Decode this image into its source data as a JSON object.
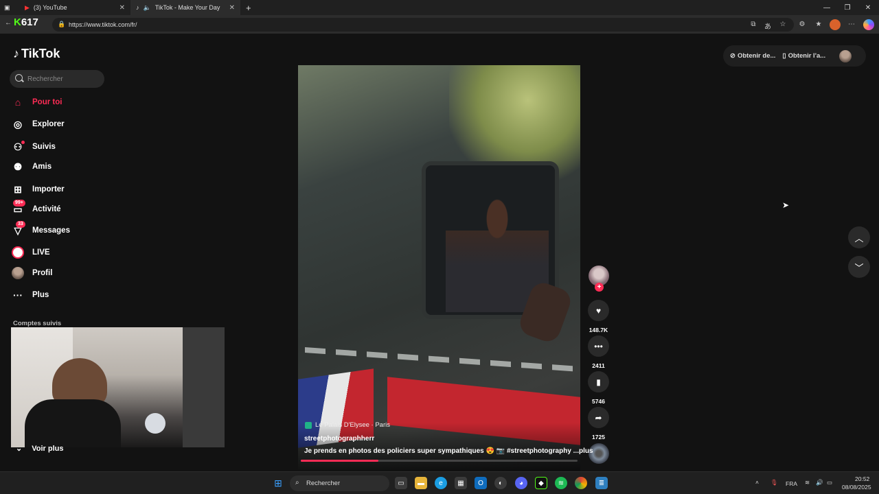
{
  "browser": {
    "tabs": [
      {
        "title": "(3) YouTube",
        "active": false
      },
      {
        "title": "TikTok - Make Your Day",
        "active": true
      }
    ],
    "new_tab": "+",
    "url": "https://www.tiktok.com/fr/",
    "extension_badge": "617"
  },
  "tiktok": {
    "logo_text": "TikTok",
    "search_placeholder": "Rechercher",
    "nav": [
      {
        "label": "Pour toi",
        "icon": "home-icon",
        "glyph": "⌂",
        "active": true
      },
      {
        "label": "Explorer",
        "icon": "compass-icon",
        "glyph": "◎"
      },
      {
        "label": "Suivis",
        "icon": "following-icon",
        "glyph": "👤"
      },
      {
        "label": "Amis",
        "icon": "friends-icon",
        "glyph": "👥"
      },
      {
        "label": "Importer",
        "icon": "upload-icon",
        "glyph": "⊞"
      },
      {
        "label": "Activité",
        "icon": "activity-icon",
        "glyph": "▭",
        "badge": "99+"
      },
      {
        "label": "Messages",
        "icon": "messages-icon",
        "glyph": "➤",
        "badge": "33"
      },
      {
        "label": "LIVE",
        "icon": "live-icon",
        "glyph": "●"
      },
      {
        "label": "Profil",
        "icon": "profile-avatar",
        "glyph": "●"
      },
      {
        "label": "Plus",
        "icon": "more-icon",
        "glyph": "···"
      }
    ],
    "followed_title": "Comptes suivis",
    "see_more": "Voir plus",
    "top_right": {
      "get_coins": "Obtenir de...",
      "get_app": "Obtenir l'a..."
    },
    "video": {
      "location": "Le Palais D'Elysee · Paris",
      "username": "streetphotographherr",
      "caption": "Je prends en photos des policiers super sympathiques 😍 📷 #streetphotography ...",
      "more": "plus",
      "progress": 0.28,
      "likes": "148.7K",
      "comments": "2411",
      "saves": "5746",
      "shares": "1725"
    }
  },
  "taskbar": {
    "search": "Rechercher",
    "lang": "FRA",
    "time": "20:52",
    "date": "08/08/2025"
  },
  "colors": {
    "accent": "#fe2c55",
    "bg": "#121212"
  }
}
